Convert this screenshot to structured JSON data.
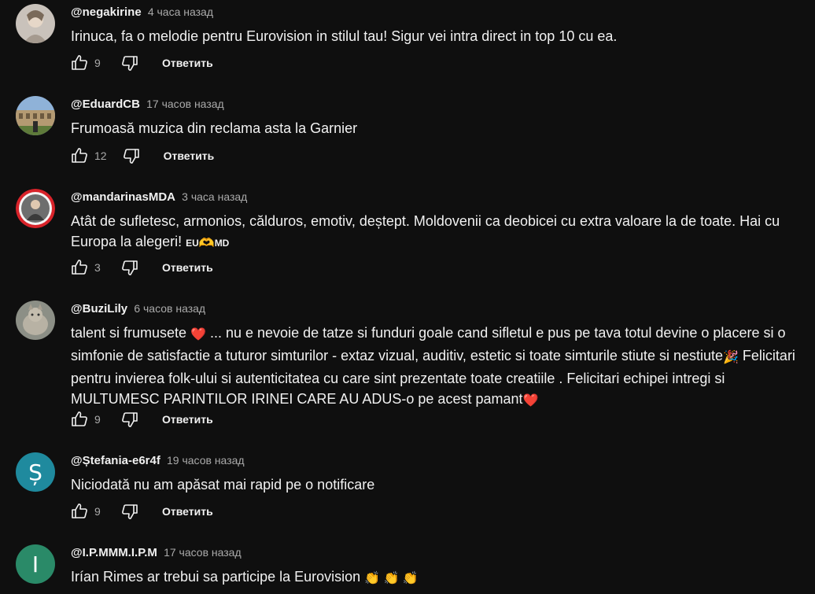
{
  "colors": {
    "background": "#0f0f0f",
    "text": "#f1f1f1",
    "muted": "#aaaaaa",
    "heart": "#e0242e",
    "avatar_stefania": "#1f8a9e",
    "avatar_ipmmm": "#2a8a68"
  },
  "comments": [
    {
      "author": "@negakirine",
      "time": "4 часа назад",
      "text": "Irinuca, fa o melodie pentru Eurovision in stilul tau! Sigur vei intra direct in top 10 cu ea.",
      "likes": "9",
      "reply": "Ответить",
      "avatar": "photo-face"
    },
    {
      "author": "@EduardCB",
      "time": "17 часов назад",
      "text": "Frumoasă muzica din reclama asta la Garnier",
      "likes": "12",
      "reply": "Ответить",
      "avatar": "photo-colosseum"
    },
    {
      "author": "@mandarinasMDA",
      "time": "3 часа назад",
      "text_line": "Atât de sufletesc, armonios, călduros, emotiv, deștept. Moldovenii ca deobicei cu extra valoare la de toate. Hai cu Europa la alegeri! ",
      "flag_eu": "EU",
      "emoji_heart_hands": "🫶",
      "flag_md": "MD",
      "likes": "3",
      "reply": "Ответить",
      "avatar": "photo-red-ring"
    },
    {
      "author": "@BuziLily",
      "time": "6 часов назад",
      "text_part1": "talent si frumusete ",
      "emoji1": "❤️",
      "text_part2": "  ... nu e nevoie de tatze si funduri goale cand sifletul e pus pe tava totul devine o placere si o simfonie de satisfactie a tuturor simturilor - extaz vizual, auditiv, estetic si toate simturile stiute si nestiute",
      "emoji2": "🎉",
      "text_part3": "  Felicitari pentru invierea folk-ului  si autenticitatea cu care sint prezentate toate creatiile . Felicitari echipei intregi si MULTUMESC PARINTILOR IRINEI CARE AU ADUS-o pe acest pamant",
      "emoji3": "❤️",
      "likes": "9",
      "reply": "Ответить",
      "avatar": "photo-cat"
    },
    {
      "author": "@Ștefania-e6r4f",
      "time": "19 часов назад",
      "text": "Niciodată nu am apăsat mai rapid pe o notificare",
      "likes": "9",
      "reply": "Ответить",
      "avatar_letter": "Ș"
    },
    {
      "author": "@I.P.MMM.I.P.M",
      "time": "17 часов назад",
      "text": "Irían Rimes ar trebui sa participe la Eurovision ",
      "emoji_clap": "👏 👏 👏",
      "avatar_letter": "I"
    }
  ],
  "icons": {
    "like": "thumb-up-icon",
    "dislike": "thumb-down-icon"
  }
}
